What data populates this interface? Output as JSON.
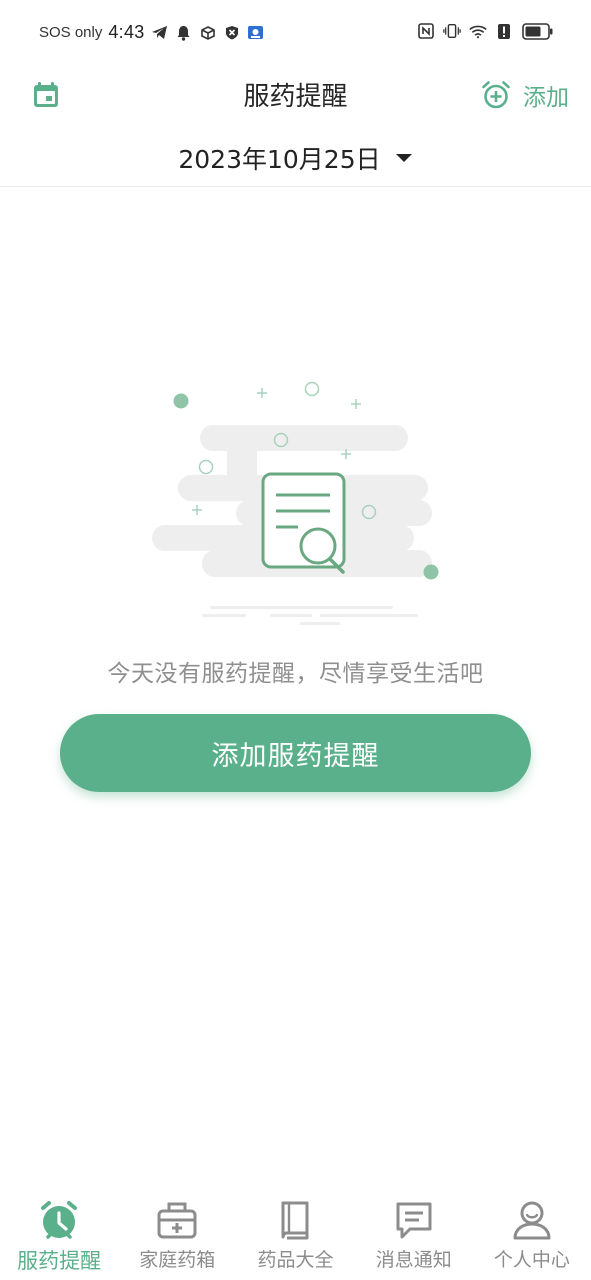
{
  "status_bar": {
    "carrier": "SOS only",
    "time": "4:43",
    "left_icons": [
      "telegram-icon",
      "bell-icon",
      "box-icon",
      "shield-icon",
      "vpn-icon"
    ],
    "right_icons": [
      "nfc-icon",
      "vibrate-icon",
      "wifi-icon",
      "alert-icon",
      "battery-icon"
    ]
  },
  "header": {
    "title": "服药提醒",
    "add_label": "添加",
    "left_icon": "calendar-icon",
    "add_icon": "alarm-add-icon"
  },
  "date_selector": {
    "date": "2023年10月25日",
    "icon": "caret-down-icon"
  },
  "empty_state": {
    "message": "今天没有服药提醒，尽情享受生活吧",
    "button_label": "添加服药提醒",
    "illustration_icon": "document-search-icon"
  },
  "bottom_nav": {
    "items": [
      {
        "label": "服药提醒",
        "icon": "alarm-clock-icon",
        "active": true
      },
      {
        "label": "家庭药箱",
        "icon": "medicine-box-icon",
        "active": false
      },
      {
        "label": "药品大全",
        "icon": "book-icon",
        "active": false
      },
      {
        "label": "消息通知",
        "icon": "message-icon",
        "active": false
      },
      {
        "label": "个人中心",
        "icon": "person-icon",
        "active": false
      }
    ]
  },
  "colors": {
    "accent": "#5bb08c",
    "inactive": "#8c8c8c",
    "text": "#262626"
  }
}
